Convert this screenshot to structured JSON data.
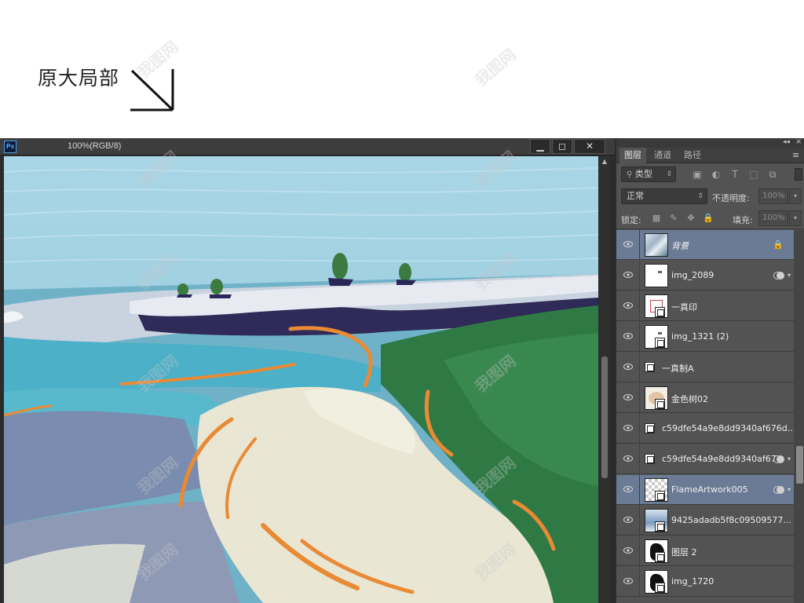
{
  "caption": {
    "text": "原大局部"
  },
  "watermark": "我图网",
  "document": {
    "title": "100%(RGB/8)",
    "app_icon": "Ps",
    "window_buttons": {
      "minimize": "▁",
      "maximize": "◻",
      "close": "✕"
    }
  },
  "layers_panel": {
    "tabs": [
      {
        "label": "图层",
        "active": true
      },
      {
        "label": "通道",
        "active": false
      },
      {
        "label": "路径",
        "active": false
      }
    ],
    "filter": {
      "label": "类型"
    },
    "blend_mode": "正常",
    "opacity": {
      "label": "不透明度:",
      "value": "100%"
    },
    "lock": {
      "label": "锁定:"
    },
    "fill": {
      "label": "填充:",
      "value": "100%"
    },
    "layers": [
      {
        "name": "背景",
        "italic": true,
        "locked": true,
        "selected": true,
        "thumb": "background-thumb"
      },
      {
        "name": "img_2089",
        "fx": true,
        "thumb": "white-thumb"
      },
      {
        "name": "一真印",
        "smart": true,
        "thumb": "seal-thumb"
      },
      {
        "name": "img_1321 (2)",
        "smart": true,
        "thumb": "white-thumb"
      },
      {
        "name": "一真制A",
        "smart": true,
        "thumb": "small-smart"
      },
      {
        "name": "金色树02",
        "smart": true,
        "thumb": "tree-thumb"
      },
      {
        "name": "c59dfe54a9e8dd9340af676d...",
        "smart": true,
        "thumb": "small-smart"
      },
      {
        "name": "c59dfe54a9e8dd9340af67...",
        "smart": true,
        "fx": true,
        "thumb": "small-smart"
      },
      {
        "name": "FlameArtwork005",
        "smart": true,
        "fx": true,
        "selected": true,
        "thumb": "checker-thumb"
      },
      {
        "name": "9425adadb5f8c09509577...",
        "smart": true,
        "thumb": "blue-thumb"
      },
      {
        "name": "图层 2",
        "smart": true,
        "thumb": "ink-thumb"
      },
      {
        "name": "img_1720",
        "smart": true,
        "thumb": "ink2-thumb"
      }
    ]
  }
}
